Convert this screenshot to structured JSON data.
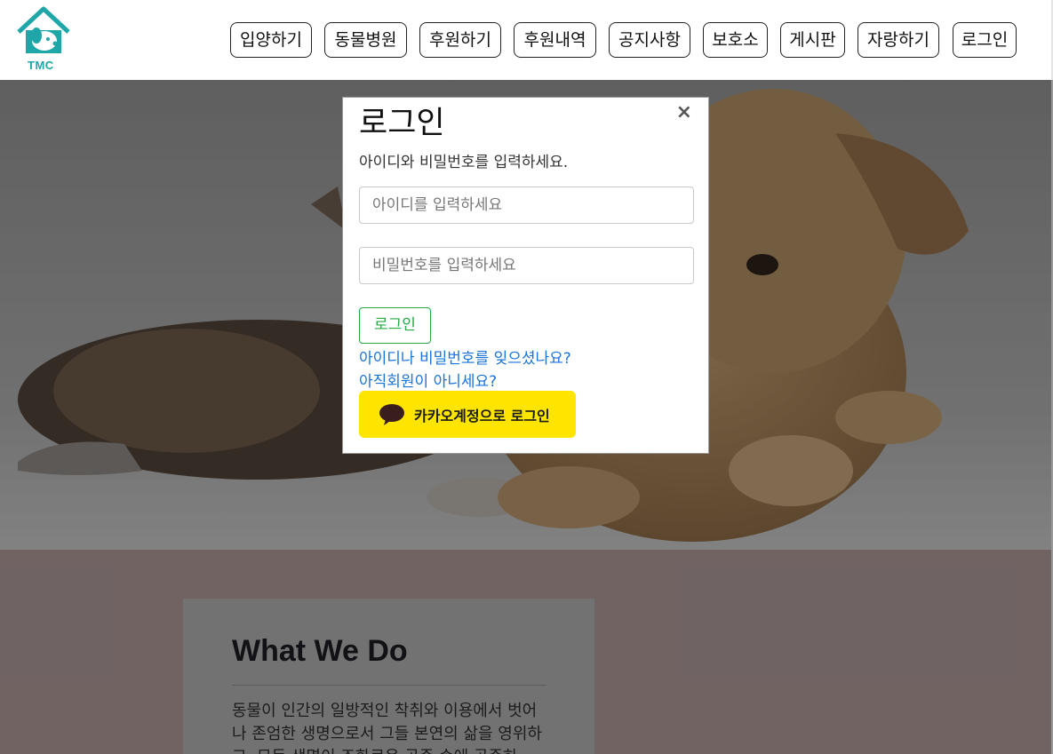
{
  "header": {
    "logo_text": "TMC",
    "nav": [
      "입양하기",
      "동물병원",
      "후원하기",
      "후원내역",
      "공지사항",
      "보호소",
      "게시판",
      "자랑하기",
      "로그인"
    ]
  },
  "about": {
    "title": "What We Do",
    "body": "동물이 인간의 일방적인 착취와 이용에서 벗어나 존엄한 생명으로서 그들 본연의 삶을 영위하고, 모든 생명이 조화로운 공존 속에 공존하"
  },
  "modal": {
    "title": "로그인",
    "close": "×",
    "subtitle": "아이디와 비밀번호를 입력하세요.",
    "id_placeholder": "아이디를 입력하세요",
    "pw_placeholder": "비밀번호를 입력하세요",
    "login_button": "로그인",
    "forgot_link": "아이디나 비밀번호를 잊으셨나요?",
    "signup_link": "아직회원이 아니세요?",
    "kakao_button": "카카오계정으로 로그인"
  },
  "colors": {
    "accent_green": "#28a745",
    "link_blue": "#1a73d9",
    "kakao_yellow": "#fee500",
    "logo_teal": "#1fa6a8"
  }
}
